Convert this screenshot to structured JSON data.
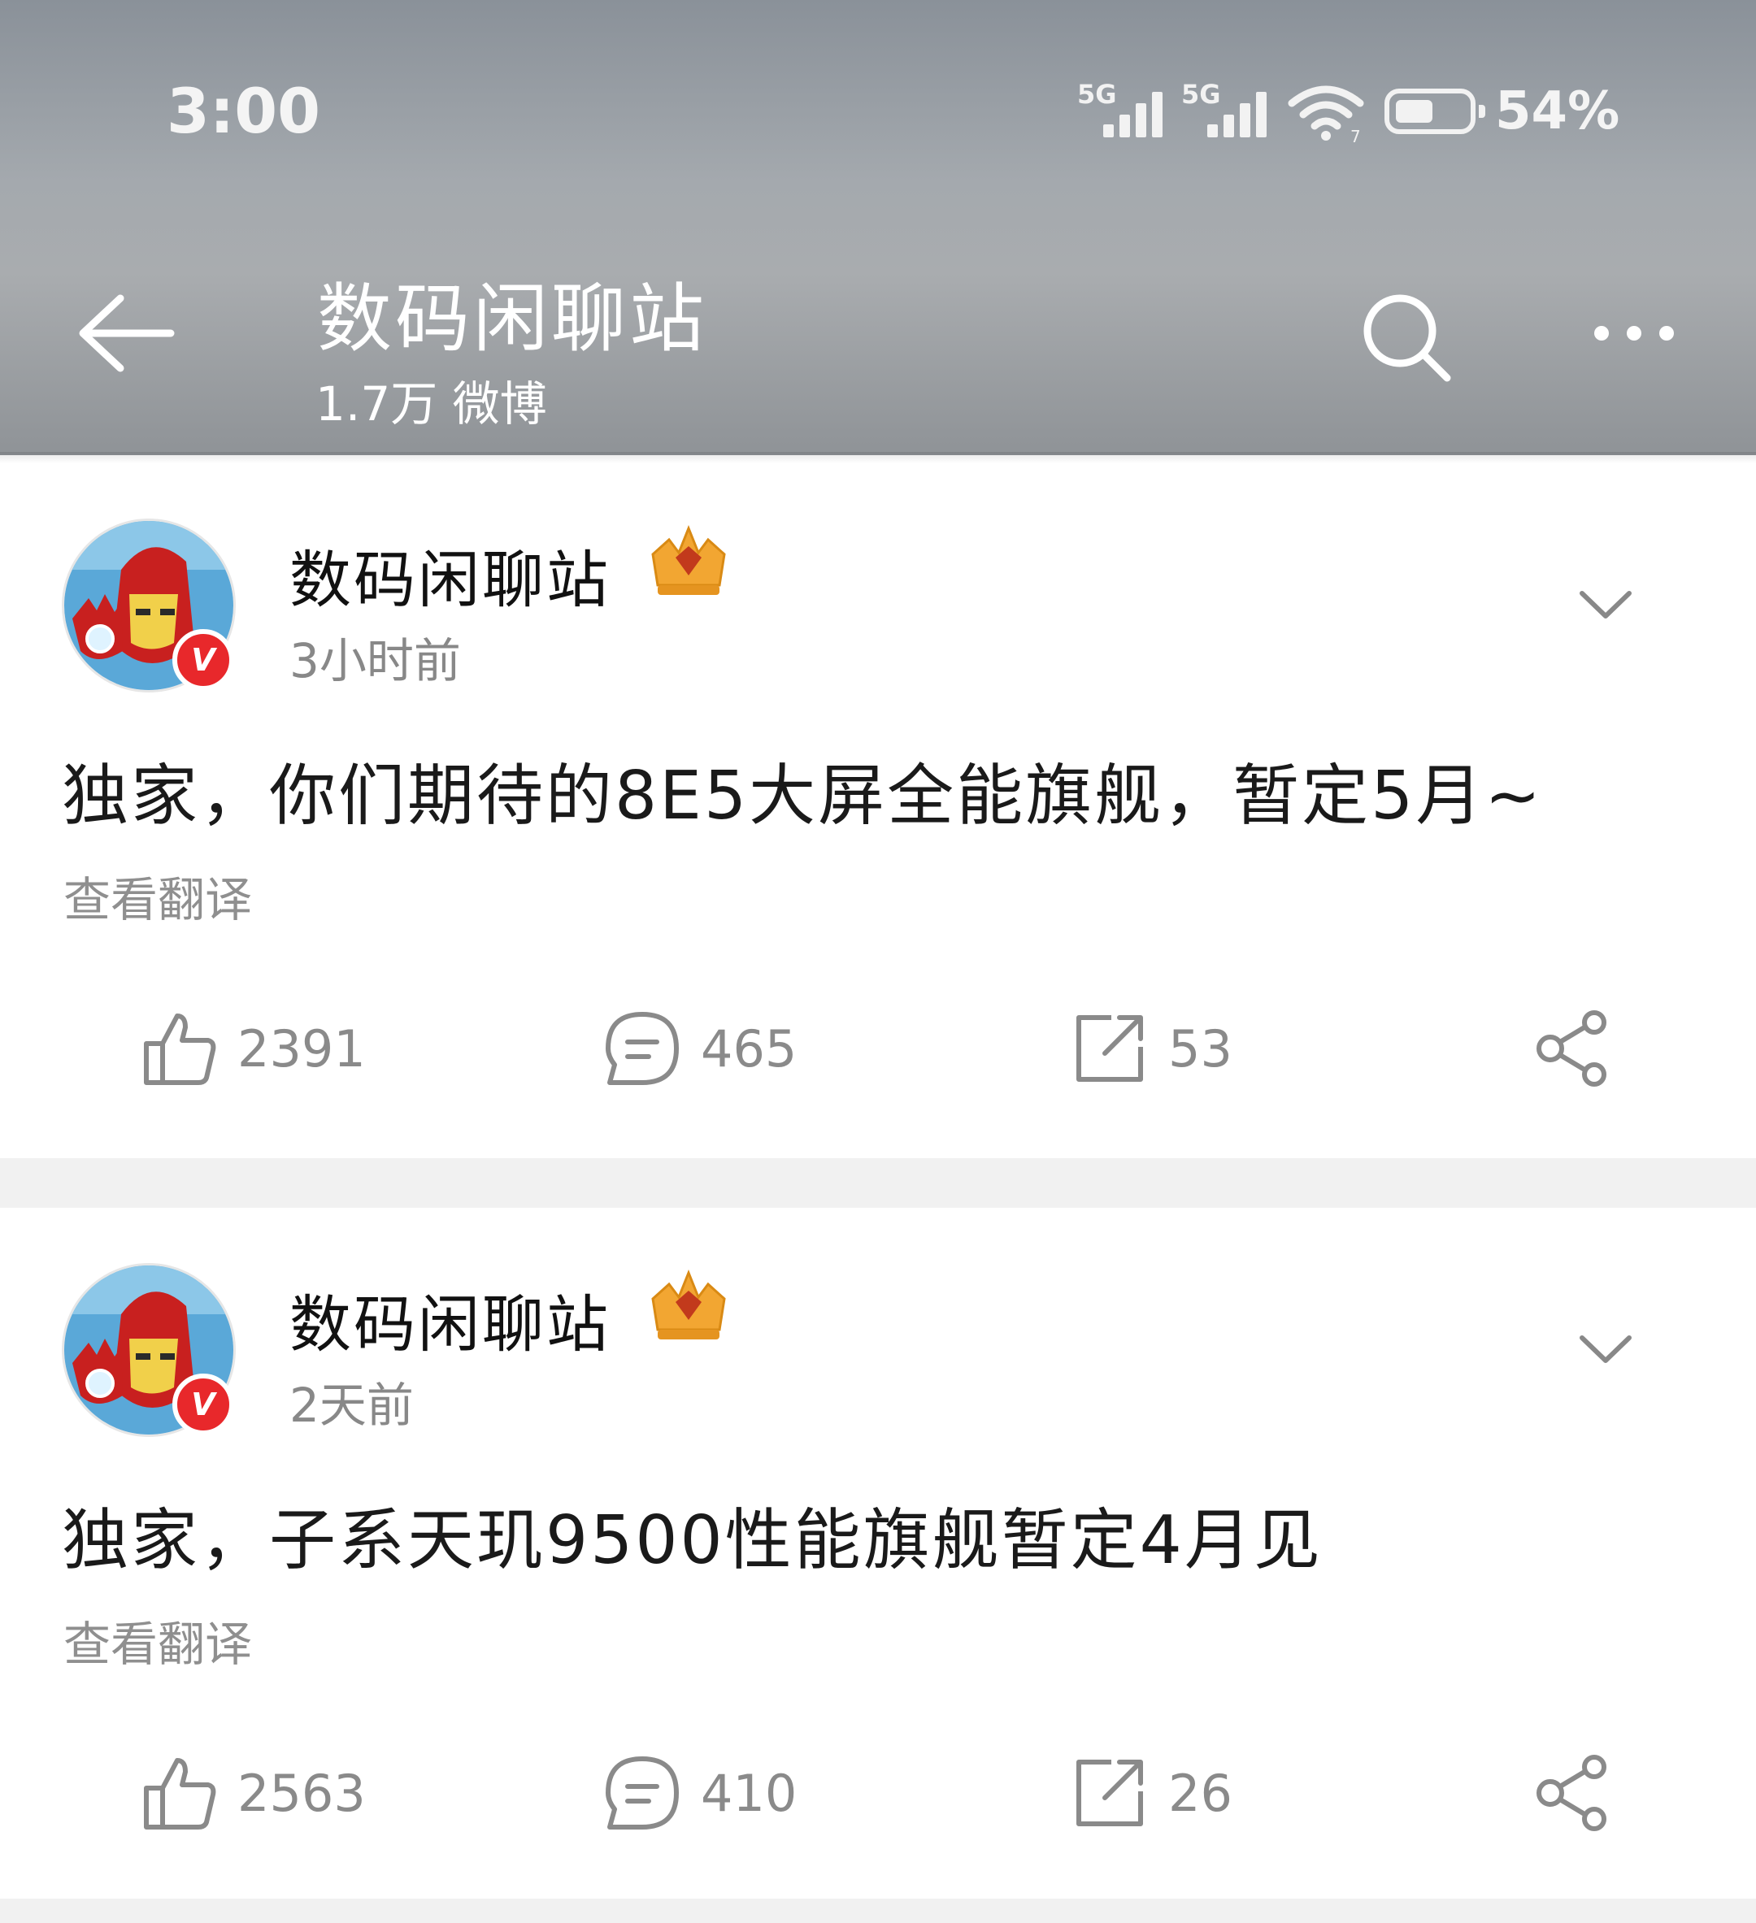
{
  "status_bar": {
    "time": "3:00",
    "signal_1": "5G",
    "signal_2": "5G",
    "battery_text": "54%",
    "battery_level": 0.54
  },
  "header": {
    "title": "数码闲聊站",
    "subtitle": "1.7万 微博",
    "icons": [
      "back-arrow-icon",
      "search-icon",
      "more-icon"
    ]
  },
  "posts": [
    {
      "author": "数码闲聊站",
      "verified_badge": "V",
      "timestamp": "3小时前",
      "text": "独家，你们期待的8E5大屏全能旗舰，暂定5月~",
      "translate_label": "查看翻译",
      "likes": "2391",
      "comments": "465",
      "reposts": "53"
    },
    {
      "author": "数码闲聊站",
      "verified_badge": "V",
      "timestamp": "2天前",
      "text": "独家，子系天玑9500性能旗舰暂定4月见",
      "translate_label": "查看翻译",
      "likes": "2563",
      "comments": "410",
      "reposts": "26"
    }
  ],
  "colors": {
    "header_bg": "#a4a9ae",
    "verified_red": "#e8282b",
    "crown_gold": "#f2a632",
    "muted_text": "#8a8a8a",
    "separator": "#f1f1f1"
  }
}
